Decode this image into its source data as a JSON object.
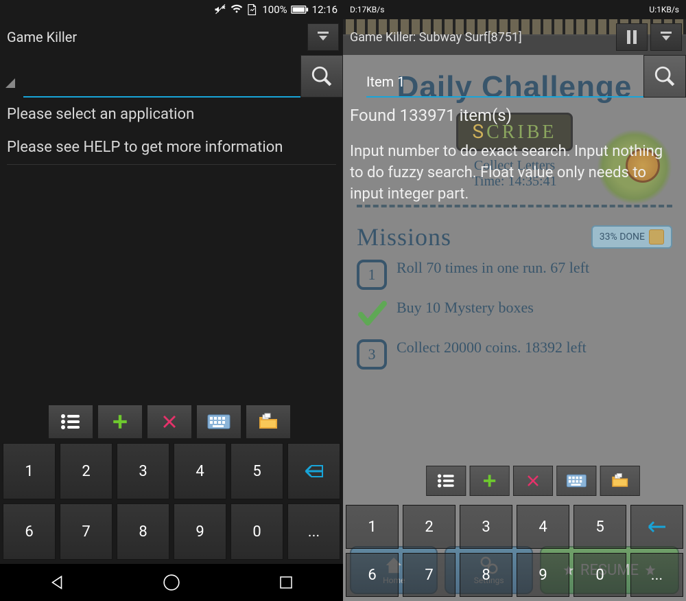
{
  "left": {
    "status": {
      "battery": "100%",
      "time": "12:16"
    },
    "header": {
      "title": "Game Killer"
    },
    "content": {
      "line1": "Please select an application",
      "line2": "Please see HELP to get more information"
    },
    "keypad": [
      "1",
      "2",
      "3",
      "4",
      "5",
      "",
      "6",
      "7",
      "8",
      "9",
      "0",
      "..."
    ]
  },
  "right": {
    "status": {
      "down": "D:17KB/s",
      "up": "U:1KB/s"
    },
    "header": {
      "title": "Game Killer: Subway Surf[8751]"
    },
    "search": {
      "value": "Item 1"
    },
    "content": {
      "found": "Found 133971 item(s)",
      "help": "Input number to do exact search. Input nothing to do fuzzy search. Float value only needs to input integer part."
    },
    "keypad": [
      "1",
      "2",
      "3",
      "4",
      "5",
      "",
      "6",
      "7",
      "8",
      "9",
      "0",
      "..."
    ],
    "game": {
      "daily_title": "Daily Challenge",
      "collect": "Collect Letters",
      "timer": "Time: 14:35:41",
      "missions_title": "Missions",
      "done_pct": "33% DONE",
      "mission1": "Roll 70 times in one run. 67 left",
      "mission2": "Buy 10 Mystery boxes",
      "mission3": "Collect 20000 coins. 18392 left",
      "home": "Home",
      "settings": "Settings",
      "resume": "RESUME"
    }
  }
}
